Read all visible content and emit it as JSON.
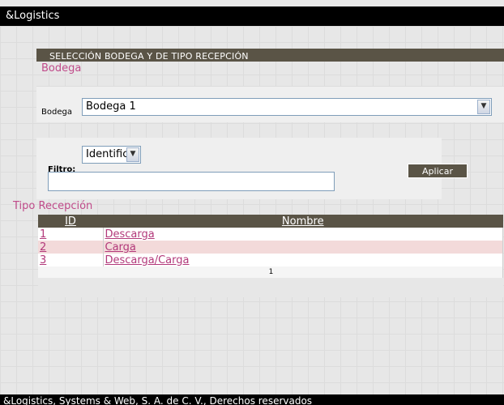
{
  "app": {
    "title": "&Logistics"
  },
  "seleccion": {
    "header": "SELECCIÓN BODEGA Y DE TIPO RECEPCIÓN"
  },
  "bodega": {
    "section_title": "Bodega",
    "label": "Bodega",
    "selected": "Bodega 1"
  },
  "filtro": {
    "label": "Filtro:",
    "field_selected": "Identific",
    "value": "",
    "apply_label": "Aplicar"
  },
  "tipo_recepcion": {
    "section_title": "Tipo Recepción",
    "columns": {
      "id": "ID",
      "nombre": "Nombre"
    },
    "rows": [
      {
        "id": "1",
        "nombre": "Descarga"
      },
      {
        "id": "2",
        "nombre": "Carga"
      },
      {
        "id": "3",
        "nombre": "Descarga/Carga"
      }
    ],
    "page": "1"
  },
  "footer": {
    "text": "&Logistics, Systems & Web, S. A. de C. V., Derechos reservados"
  },
  "colors": {
    "header_bg": "#5a5446",
    "accent": "#c04b8a",
    "row_alt": "#f3dada"
  }
}
